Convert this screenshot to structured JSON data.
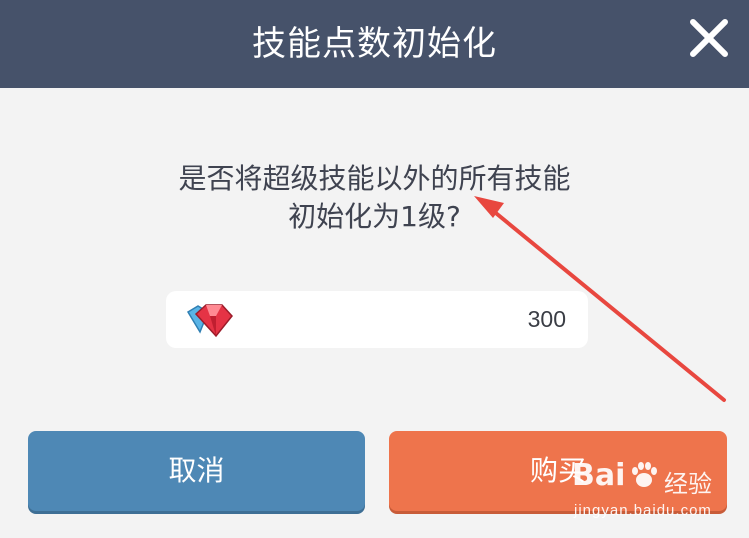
{
  "dialog": {
    "title": "技能点数初始化",
    "close_icon": "close-icon",
    "message_line1": "是否将超级技能以外的所有技能",
    "message_line2": "初始化为1级?",
    "cost": {
      "icon": "red-gem-icon",
      "value": "300"
    },
    "buttons": {
      "cancel": "取消",
      "buy": "购买"
    }
  },
  "annotation": {
    "arrow_color": "#e8473f"
  },
  "watermark": {
    "logo": "Bai",
    "logo_suffix": "经验",
    "url": "jingyan.baidu.com"
  },
  "colors": {
    "header": "#46526a",
    "cancel": "#4e88b5",
    "buy": "#ee744c"
  }
}
